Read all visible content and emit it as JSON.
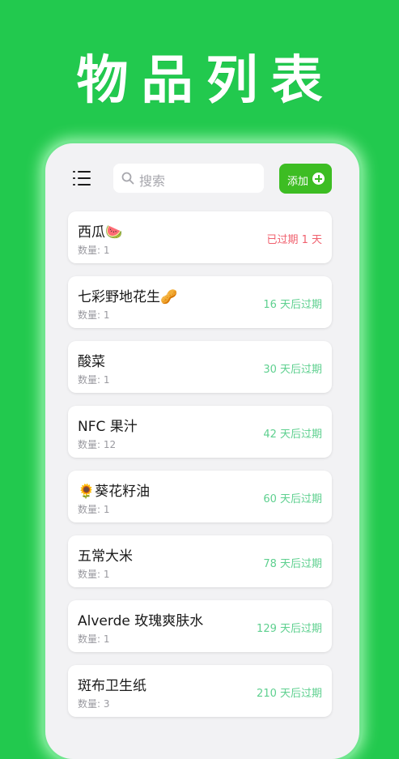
{
  "hero": {
    "title": "物品列表"
  },
  "colors": {
    "background": "#22c94e",
    "accent": "#3dbd23",
    "expired": "#f0606e",
    "upcoming": "#5ed08f"
  },
  "header": {
    "menu_icon": "menu-icon",
    "search_placeholder": "搜索",
    "add_label": "添加",
    "add_icon": "plus-circle-icon"
  },
  "items": [
    {
      "name": "西瓜🍉",
      "quantity": "数量: 1",
      "status": "已过期 1 天",
      "expired": true
    },
    {
      "name": "七彩野地花生🥜",
      "quantity": "数量: 1",
      "status": "16 天后过期",
      "expired": false
    },
    {
      "name": "酸菜",
      "quantity": "数量: 1",
      "status": "30 天后过期",
      "expired": false
    },
    {
      "name": "NFC 果汁",
      "quantity": "数量: 12",
      "status": "42 天后过期",
      "expired": false
    },
    {
      "name": "🌻葵花籽油",
      "quantity": "数量: 1",
      "status": "60 天后过期",
      "expired": false
    },
    {
      "name": "五常大米",
      "quantity": "数量: 1",
      "status": "78 天后过期",
      "expired": false
    },
    {
      "name": "Alverde 玫瑰爽肤水",
      "quantity": "数量: 1",
      "status": "129 天后过期",
      "expired": false
    },
    {
      "name": "斑布卫生纸",
      "quantity": "数量: 3",
      "status": "210 天后过期",
      "expired": false
    }
  ]
}
